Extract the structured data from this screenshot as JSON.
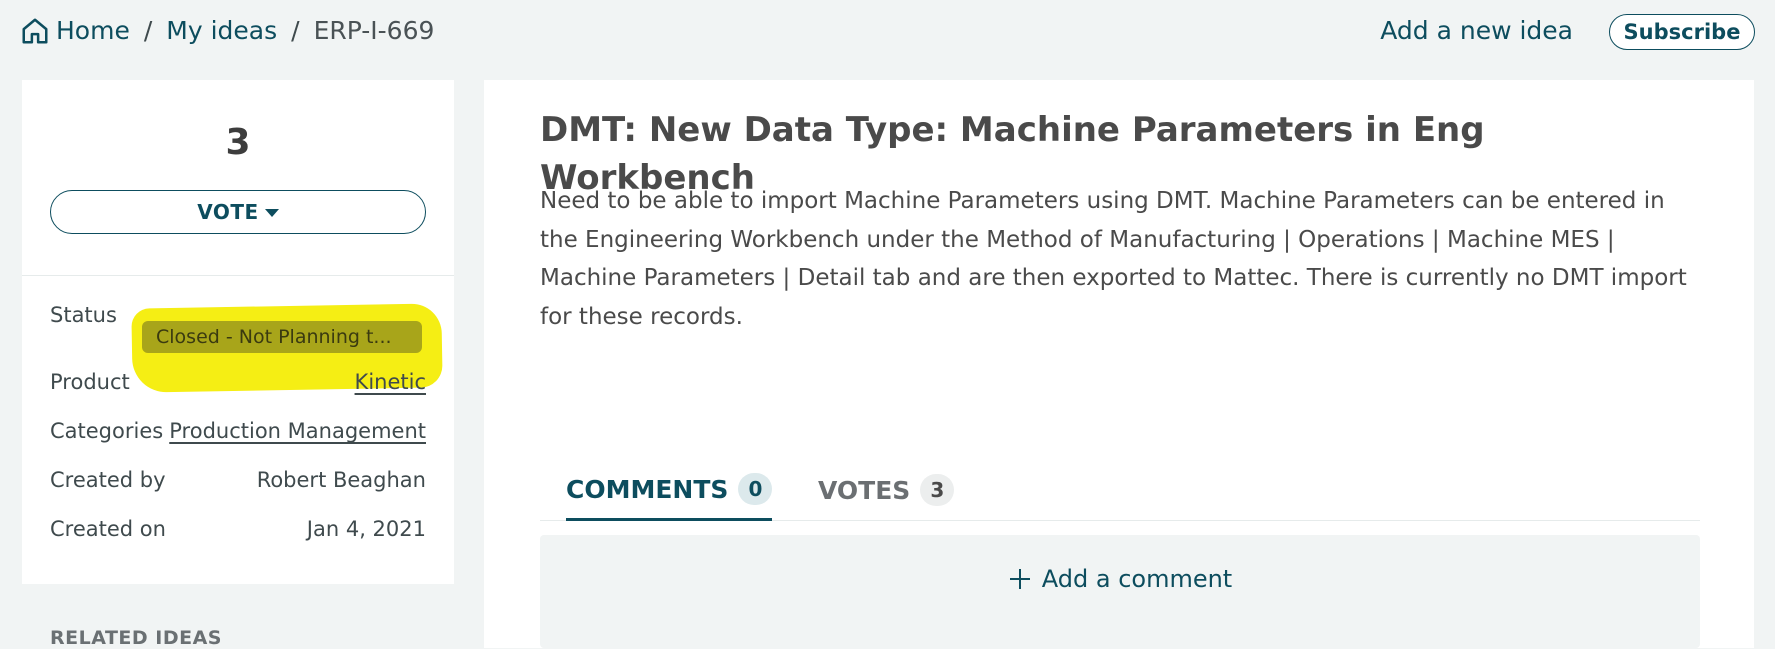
{
  "breadcrumb": {
    "home": "Home",
    "my_ideas": "My ideas",
    "current": "ERP-I-669",
    "separator": "/"
  },
  "header": {
    "add_idea": "Add a new idea",
    "subscribe": "Subscribe"
  },
  "sidebar": {
    "vote_count": "3",
    "vote_button": "VOTE",
    "status_label": "Status",
    "status_value": "Closed - Not Planning t...",
    "product_label": "Product",
    "product_value": "Kinetic",
    "categories_label": "Categories",
    "categories_value": "Production Management",
    "created_by_label": "Created by",
    "created_by_value": "Robert Beaghan",
    "created_on_label": "Created on",
    "created_on_value": "Jan 4, 2021",
    "related_heading": "RELATED IDEAS"
  },
  "main": {
    "title": "DMT: New Data Type: Machine Parameters in Eng Workbench",
    "description": "Need to be able to import Machine Parameters using DMT. Machine Parameters can be entered in the Engineering Workbench under the Method of Manufacturing | Operations | Machine MES | Machine Parameters | Detail tab and are then exported to Mattec. There is currently no DMT import for these records.",
    "tabs": [
      {
        "label": "COMMENTS",
        "count": "0"
      },
      {
        "label": "VOTES",
        "count": "3"
      }
    ],
    "add_comment": "Add a comment"
  },
  "colors": {
    "accent": "#0d4d5e",
    "highlight": "#f5ee14",
    "status_badge": "#a8a51a",
    "page_bg": "#f1f4f4"
  },
  "icons": {
    "home": "home-icon",
    "caret": "caret-down-icon",
    "plus": "plus-icon"
  }
}
